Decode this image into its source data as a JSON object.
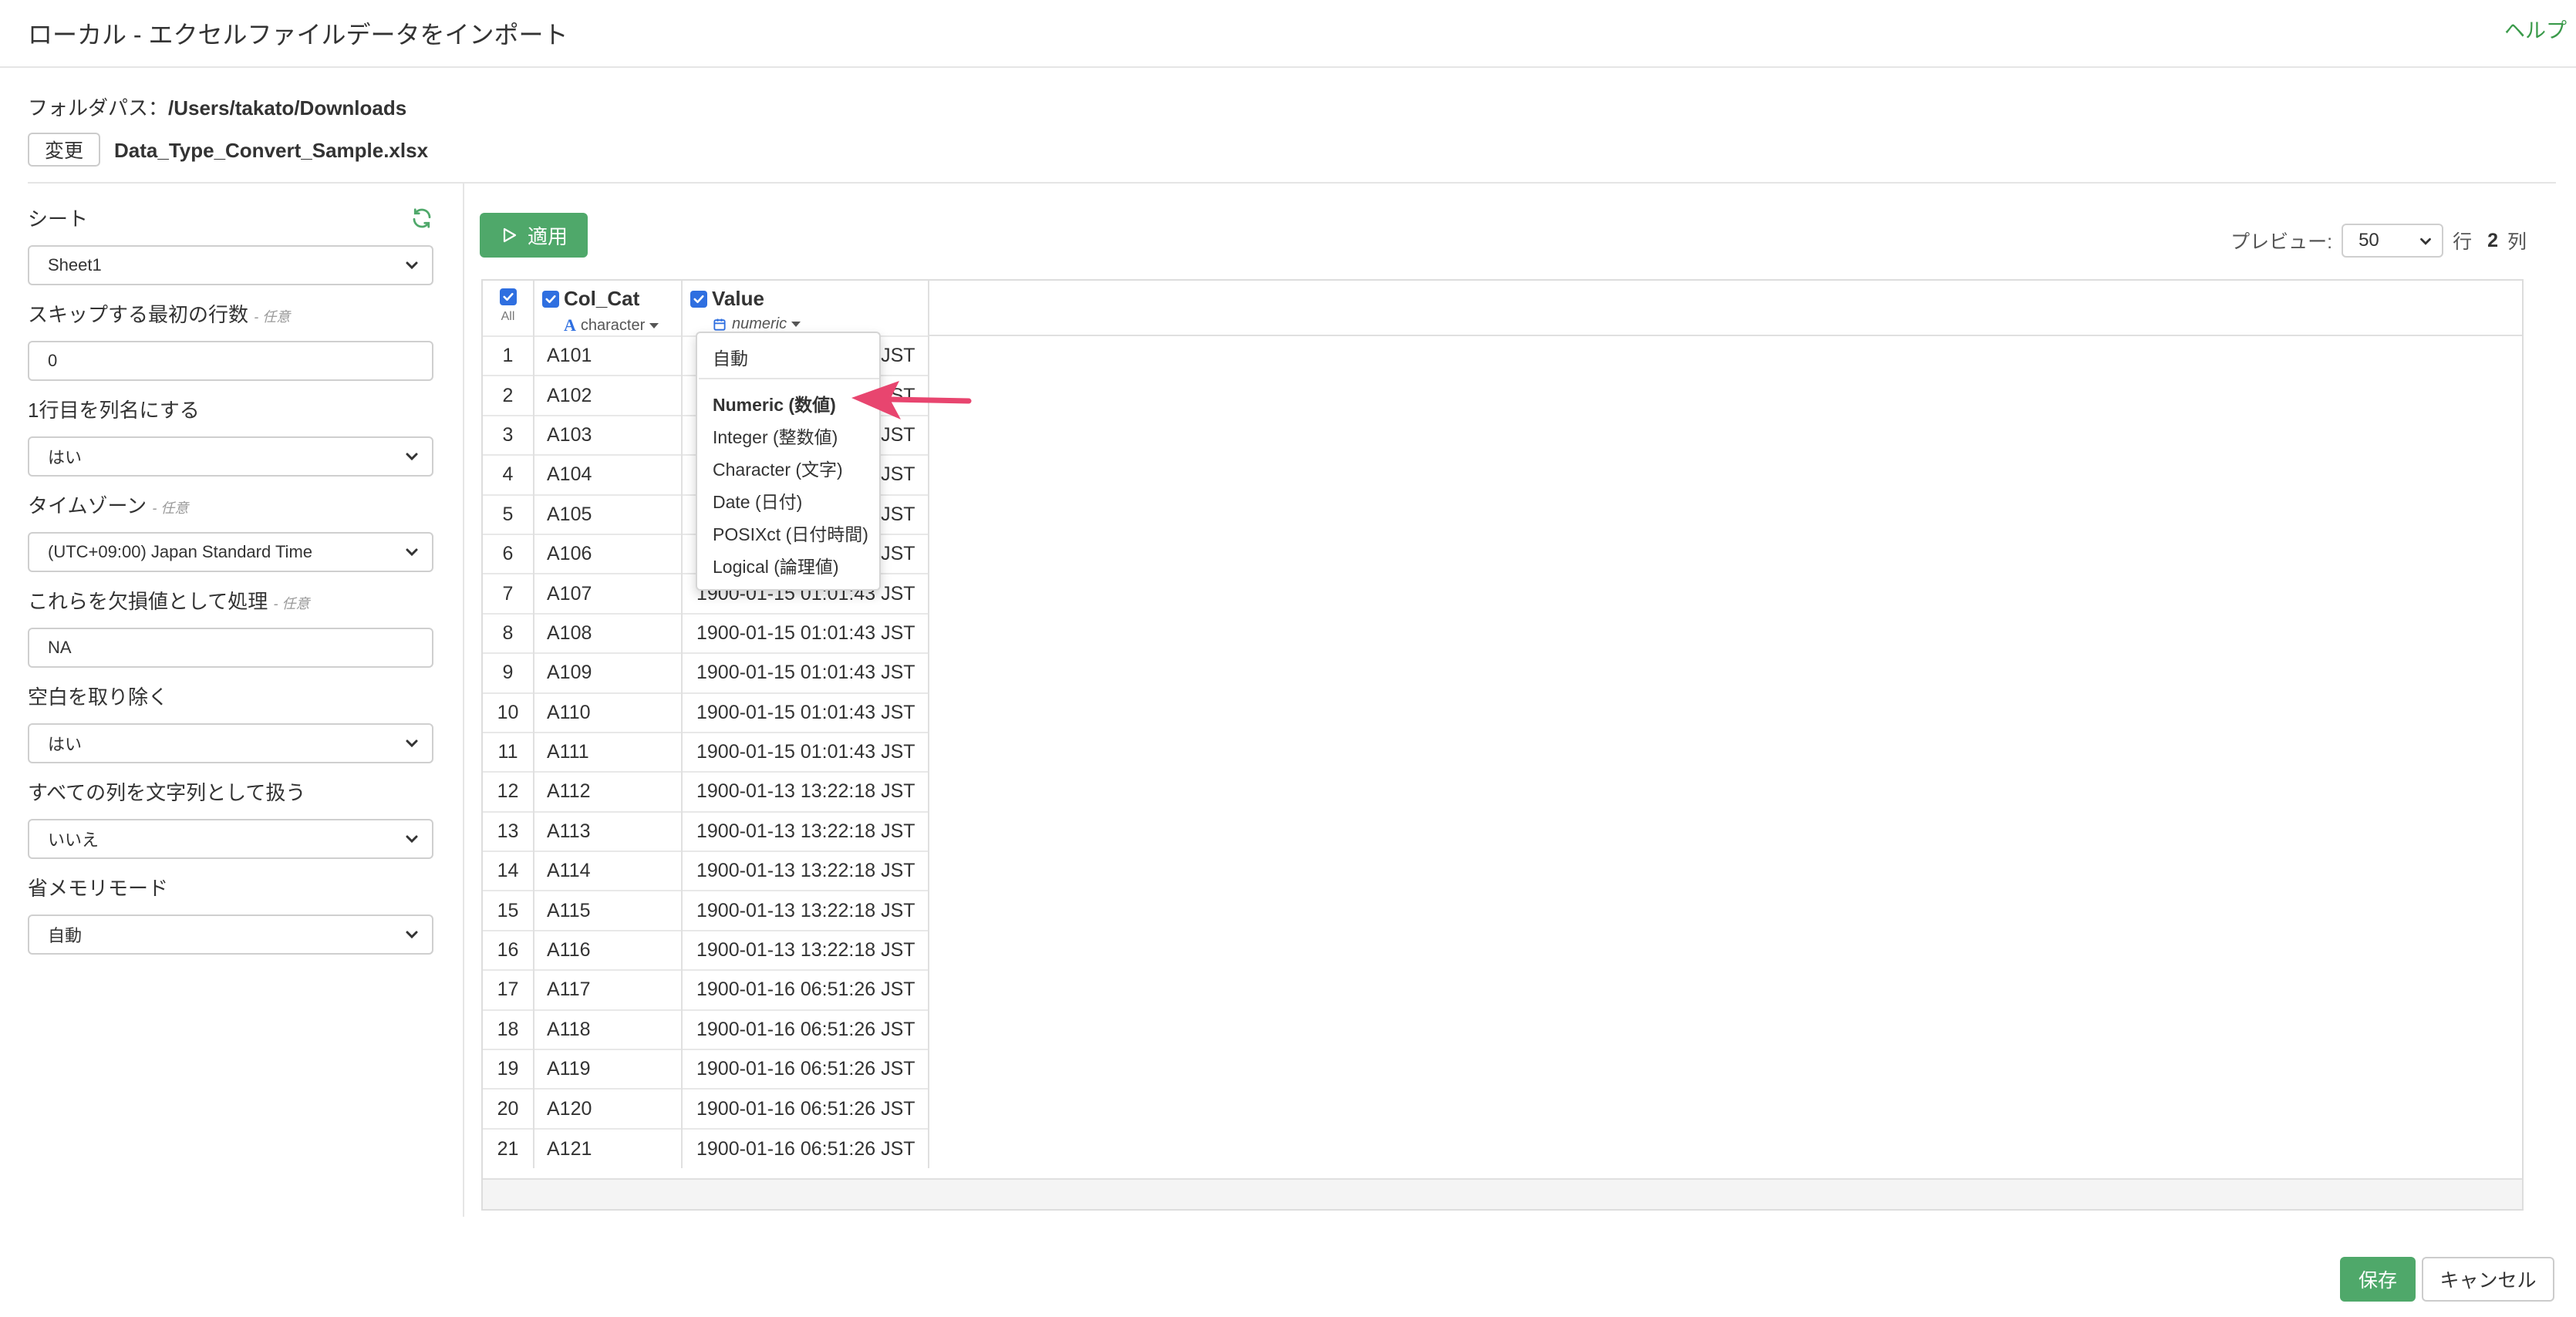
{
  "header": {
    "title": "ローカル - エクセルファイルデータをインポート",
    "help": "ヘルプ"
  },
  "folder": {
    "label": "フォルダパス：",
    "path": "/Users/takato/Downloads",
    "change_label": "変更",
    "file_name": "Data_Type_Convert_Sample.xlsx"
  },
  "sidebar": {
    "optional": "- 任意",
    "fields": [
      {
        "label": "シート",
        "value": "Sheet1",
        "optional": false,
        "refresh_icon": "refresh-icon"
      },
      {
        "label": "スキップする最初の行数",
        "value": "0",
        "optional": true,
        "kind": "input"
      },
      {
        "label": "1行目を列名にする",
        "value": "はい",
        "optional": false
      },
      {
        "label": "タイムゾーン",
        "value": "(UTC+09:00) Japan Standard Time",
        "optional": true
      },
      {
        "label": "これらを欠損値として処理",
        "value": "NA",
        "optional": true,
        "kind": "input"
      },
      {
        "label": "空白を取り除く",
        "value": "はい",
        "optional": false
      },
      {
        "label": "すべての列を文字列として扱う",
        "value": "いいえ",
        "optional": false
      },
      {
        "label": "省メモリモード",
        "value": "自動",
        "optional": false
      }
    ]
  },
  "toolbar": {
    "apply_label": "適用",
    "preview_label": "プレビュー:",
    "preview_value": "50",
    "rows_unit": "行",
    "col_count": "2",
    "cols_unit": "列"
  },
  "grid": {
    "all_label": "All",
    "columns": [
      {
        "name": "Col_Cat",
        "type": "character"
      },
      {
        "name": "Value",
        "type": "numeric"
      }
    ],
    "rows": [
      [
        "1",
        "A101",
        "1900-01-15 01:01:43 JST"
      ],
      [
        "2",
        "A102",
        "1900-01-15 01:01:43 JST"
      ],
      [
        "3",
        "A103",
        "1900-01-15 01:01:43 JST"
      ],
      [
        "4",
        "A104",
        "1900-01-15 01:01:43 JST"
      ],
      [
        "5",
        "A105",
        "1900-01-15 01:01:43 JST"
      ],
      [
        "6",
        "A106",
        "1900-01-15 01:01:43 JST"
      ],
      [
        "7",
        "A107",
        "1900-01-15 01:01:43 JST"
      ],
      [
        "8",
        "A108",
        "1900-01-15 01:01:43 JST"
      ],
      [
        "9",
        "A109",
        "1900-01-15 01:01:43 JST"
      ],
      [
        "10",
        "A110",
        "1900-01-15 01:01:43 JST"
      ],
      [
        "11",
        "A111",
        "1900-01-15 01:01:43 JST"
      ],
      [
        "12",
        "A112",
        "1900-01-13 13:22:18 JST"
      ],
      [
        "13",
        "A113",
        "1900-01-13 13:22:18 JST"
      ],
      [
        "14",
        "A114",
        "1900-01-13 13:22:18 JST"
      ],
      [
        "15",
        "A115",
        "1900-01-13 13:22:18 JST"
      ],
      [
        "16",
        "A116",
        "1900-01-13 13:22:18 JST"
      ],
      [
        "17",
        "A117",
        "1900-01-16 06:51:26 JST"
      ],
      [
        "18",
        "A118",
        "1900-01-16 06:51:26 JST"
      ],
      [
        "19",
        "A119",
        "1900-01-16 06:51:26 JST"
      ],
      [
        "20",
        "A120",
        "1900-01-16 06:51:26 JST"
      ],
      [
        "21",
        "A121",
        "1900-01-16 06:51:26 JST"
      ]
    ]
  },
  "type_menu": {
    "items": [
      "自動",
      "Numeric (数値)",
      "Integer (整数値)",
      "Character (文字)",
      "Date (日付)",
      "POSIXct (日付時間)",
      "Logical (論理値)"
    ],
    "selected_index": 1
  },
  "footer": {
    "save_label": "保存",
    "cancel_label": "キャンセル"
  },
  "colors": {
    "accent_green": "#4fa86a",
    "checkbox_blue": "#2f6fe0",
    "arrow_pink": "#e8456f"
  }
}
